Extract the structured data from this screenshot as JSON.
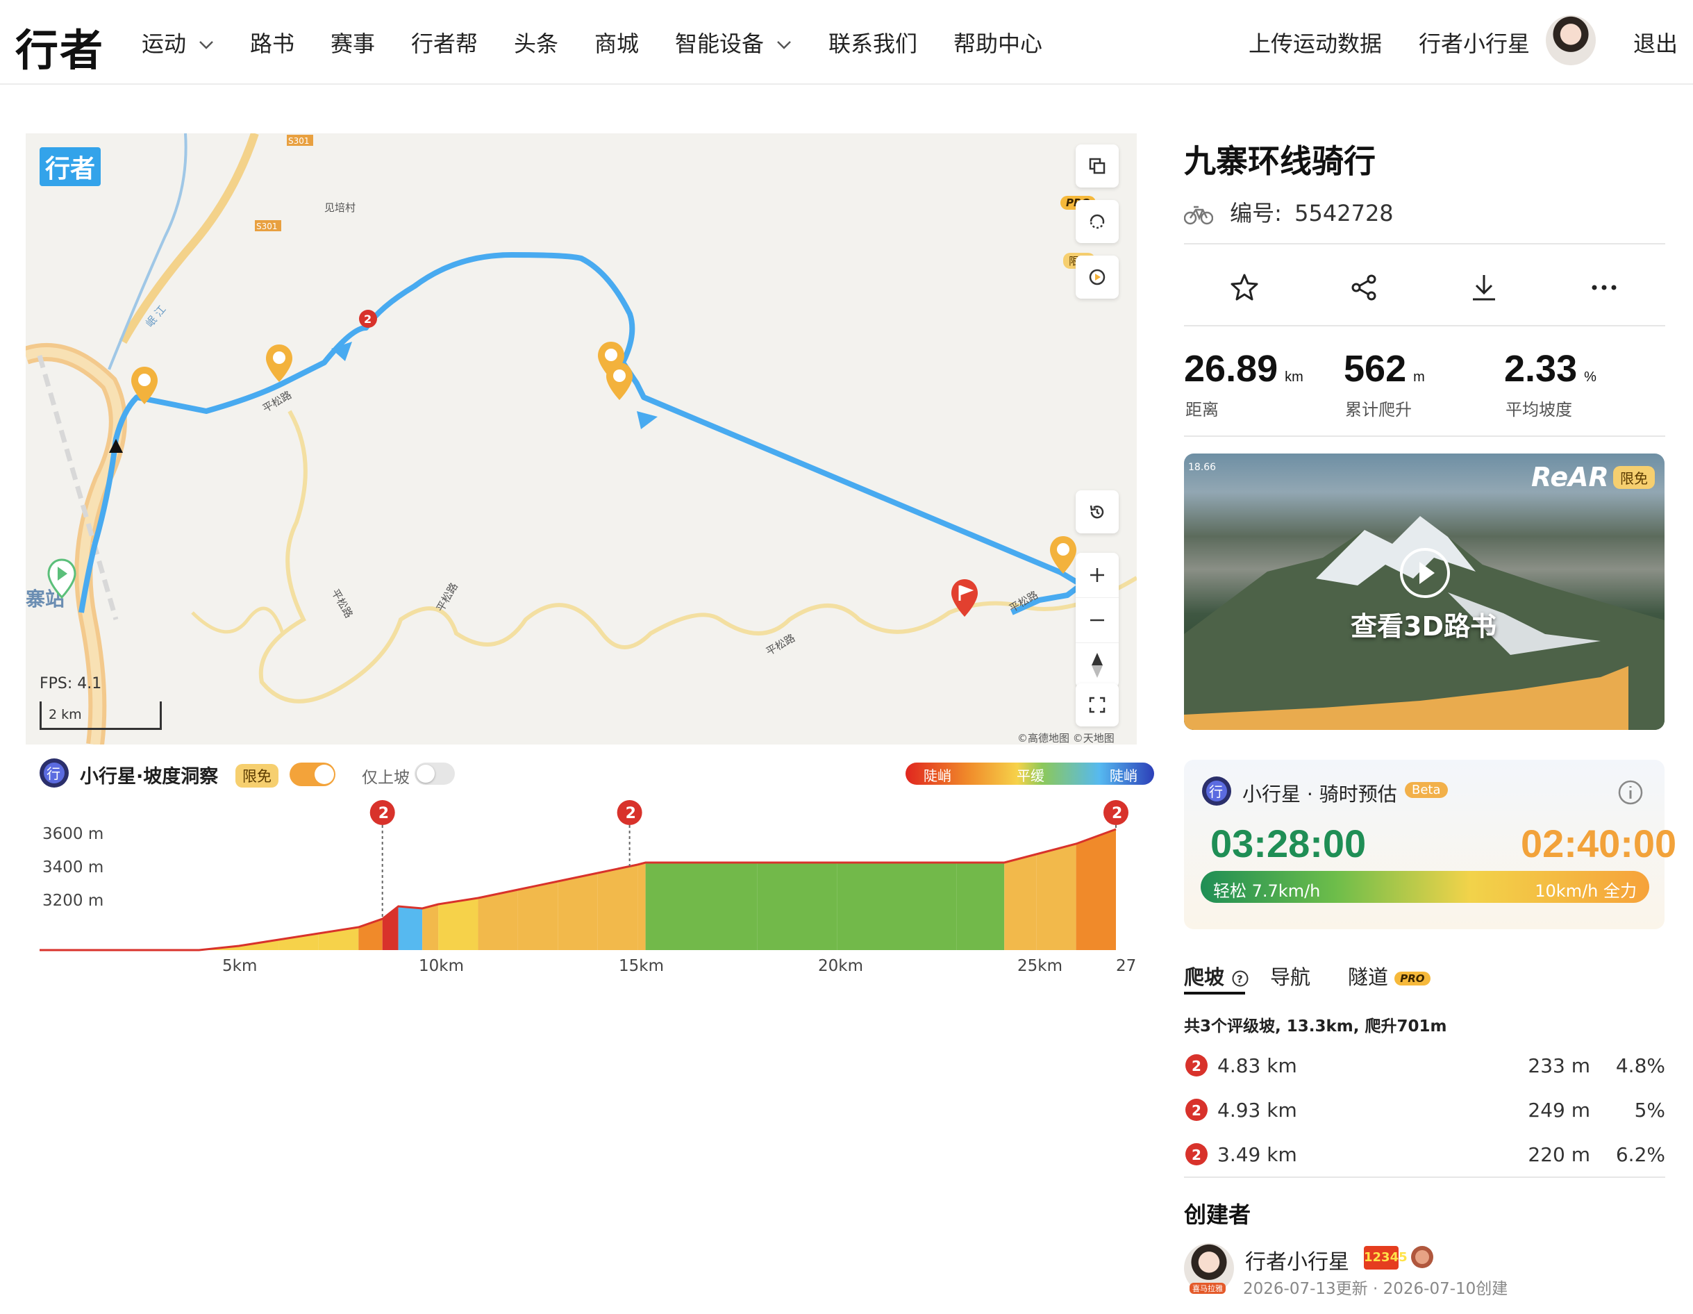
{
  "header": {
    "logo": "行者",
    "nav": [
      {
        "label": "运动",
        "has_dropdown": true
      },
      {
        "label": "路书"
      },
      {
        "label": "赛事"
      },
      {
        "label": "行者帮"
      },
      {
        "label": "头条"
      },
      {
        "label": "商城"
      },
      {
        "label": "智能设备",
        "has_dropdown": true
      },
      {
        "label": "联系我们"
      },
      {
        "label": "帮助中心"
      }
    ],
    "upload": "上传运动数据",
    "username": "行者小行星",
    "logout": "退出"
  },
  "map": {
    "logo": "行者",
    "fps": "FPS: 4.1",
    "scale": "2 km",
    "attribution": "©高德地图  ©天地图",
    "tag_pro": "PRO",
    "tag_free": "限免",
    "labels": {
      "village": "见培村",
      "road1": "S301",
      "road2": "S301",
      "road3": "平松路",
      "road4": "平松路",
      "road5": "平松路",
      "road6": "平松路",
      "road7": "平松路",
      "road8": "平松路",
      "station": "寨站",
      "river": "岷 江"
    },
    "route_color": "#48aaf0"
  },
  "slope": {
    "title": "小行星·坡度洞察",
    "free_tag": "限免",
    "uphill_only": "仅上坡",
    "legend": [
      "陡峭",
      "平缓",
      "陡峭"
    ]
  },
  "chart_data": {
    "type": "area",
    "title": "",
    "xlabel": "",
    "ylabel": "",
    "y_ticks": [
      "3600 m",
      "3400 m",
      "3200 m"
    ],
    "x_ticks": [
      "5km",
      "10km",
      "15km",
      "20km",
      "25km",
      "27km"
    ],
    "x": [
      0,
      2,
      4,
      5,
      6,
      7,
      8,
      8.6,
      9,
      9.6,
      10,
      11,
      12,
      13,
      14,
      15,
      15.2,
      18,
      20,
      23,
      24.2,
      25,
      26,
      27
    ],
    "elevation_m": [
      3040,
      3040,
      3040,
      3060,
      3090,
      3120,
      3150,
      3190,
      3250,
      3240,
      3260,
      3290,
      3330,
      3370,
      3410,
      3450,
      3460,
      3460,
      3460,
      3460,
      3460,
      3500,
      3550,
      3620
    ],
    "climb_markers_km": [
      8.6,
      14.8,
      27
    ],
    "ylim": [
      3040,
      3700
    ]
  },
  "route": {
    "title": "九寨环线骑行",
    "id_label": "编号:",
    "id": "5542728",
    "stats": [
      {
        "value": "26.89",
        "unit": "km",
        "label": "距离"
      },
      {
        "value": "562",
        "unit": "m",
        "label": "累计爬升"
      },
      {
        "value": "2.33",
        "unit": "%",
        "label": "平均坡度"
      }
    ],
    "video": {
      "mini": "18.66",
      "brand": "ReAR",
      "free": "限免",
      "caption": "查看3D路书"
    }
  },
  "prediction": {
    "title": "小行星 · 骑时预估",
    "beta": "Beta",
    "easy_time": "03:28:00",
    "hard_time": "02:40:00",
    "easy_label": "轻松 7.7km/h",
    "hard_label": "10km/h 全力",
    "colors": {
      "easy": "#1f8e55",
      "hard": "#f2a23a"
    }
  },
  "tabs": {
    "climb": "爬坡",
    "nav": "导航",
    "tunnel": "隧道",
    "pro": "PRO"
  },
  "climbs": {
    "summary": "共3个评级坡, 13.3km, 爬升701m",
    "rows": [
      {
        "badge": "2",
        "dist": "4.83 km",
        "gain": "233 m",
        "grade": "4.8%"
      },
      {
        "badge": "2",
        "dist": "4.93 km",
        "gain": "249 m",
        "grade": "5%"
      },
      {
        "badge": "2",
        "dist": "3.49 km",
        "gain": "220 m",
        "grade": "6.2%"
      }
    ]
  },
  "creator": {
    "heading": "创建者",
    "name": "行者小行星",
    "level": "12345",
    "badge_text": "喜马拉雅",
    "updated": "2026-07-13更新",
    "created": "2026-07-10创建"
  }
}
